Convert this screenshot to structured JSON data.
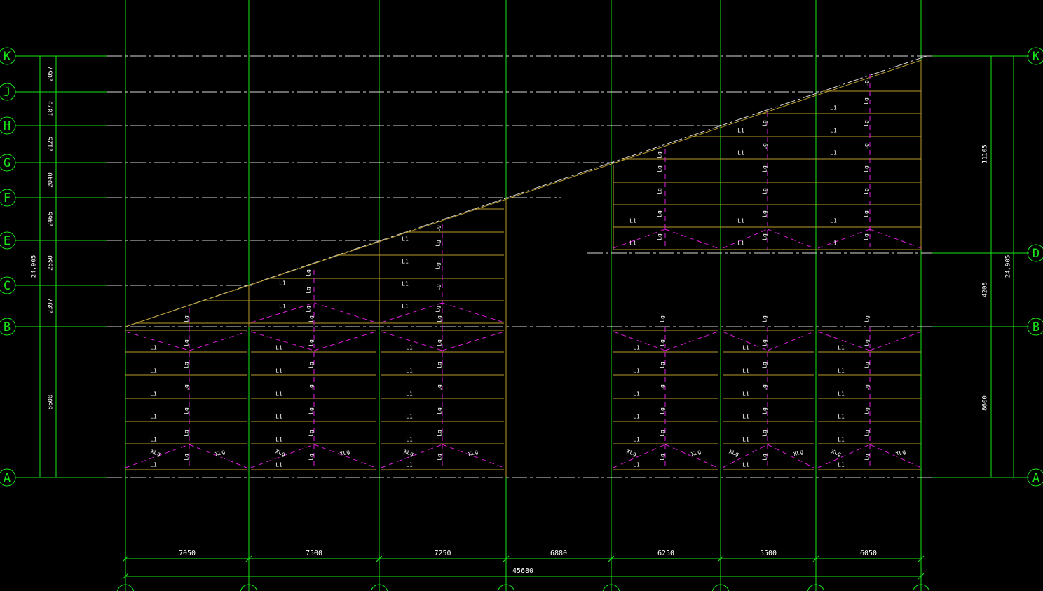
{
  "colors": {
    "background": "#000000",
    "grid": "#19e619",
    "dash": "#d8d8d8",
    "purlin": "#b99b2a",
    "brace": "#e21be2",
    "text": "#ffffff",
    "bubble": "#19e619"
  },
  "row_axes": [
    "K",
    "J",
    "H",
    "G",
    "F",
    "E",
    "C",
    "B",
    "A"
  ],
  "right_axes": [
    "K",
    "D",
    "B",
    "A"
  ],
  "left_dims": [
    "2057",
    "1870",
    "2125",
    "2040",
    "2465",
    "2550",
    "2397",
    "8600"
  ],
  "left_total": "24,905",
  "right_dims": [
    "11105",
    "4208",
    "8600"
  ],
  "right_total": "24,905",
  "bottom_dims": [
    "7050",
    "7500",
    "7250",
    "6880",
    "6250",
    "5500",
    "6050"
  ],
  "bottom_total": "45680",
  "labels": {
    "purlin": "L1",
    "tie": "Lg",
    "diag_tie": "XLg"
  }
}
